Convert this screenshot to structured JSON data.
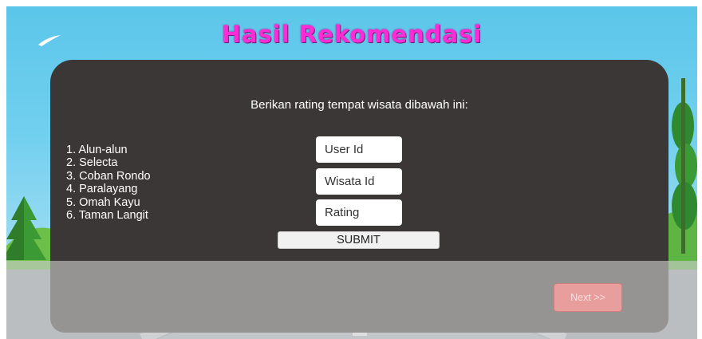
{
  "screen": {
    "title": "Hasil Rekomendasi",
    "instruction": "Berikan rating tempat wisata dibawah ini:"
  },
  "places": [
    "1. Alun-alun",
    "2. Selecta",
    "3. Coban Rondo",
    "4. Paralayang",
    "5. Omah Kayu",
    "6. Taman Langit"
  ],
  "form": {
    "user_id_placeholder": "User Id",
    "wisata_id_placeholder": "Wisata Id",
    "rating_placeholder": "Rating",
    "submit_label": "SUBMIT"
  },
  "navigation": {
    "next_label": "Next >>"
  },
  "colors": {
    "title": "#ff2bd6",
    "panel": "#3b3736",
    "sky": "#6ccdee",
    "next_button": "#e89e9c"
  }
}
